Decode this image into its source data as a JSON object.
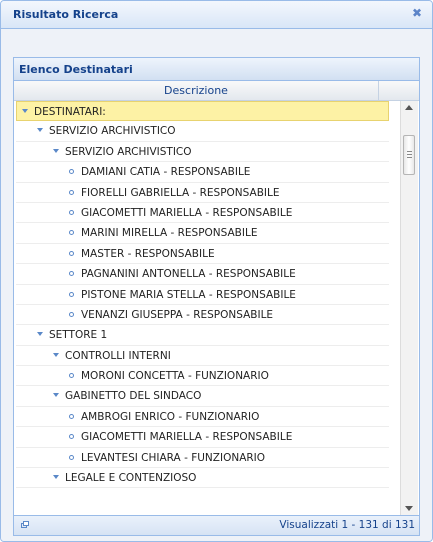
{
  "window": {
    "title": "Risultato Ricerca",
    "close_icon": "close-icon"
  },
  "panel": {
    "title": "Elenco Destinatari",
    "column_header": "Descrizione"
  },
  "tree": [
    {
      "label": "DESTINATARI:",
      "level": 0,
      "type": "folder",
      "selected": true
    },
    {
      "label": "SERVIZIO ARCHIVISTICO",
      "level": 1,
      "type": "folder"
    },
    {
      "label": "SERVIZIO ARCHIVISTICO",
      "level": 2,
      "type": "folder"
    },
    {
      "label": "DAMIANI CATIA - RESPONSABILE",
      "level": 3,
      "type": "leaf"
    },
    {
      "label": "FIORELLI GABRIELLA - RESPONSABILE",
      "level": 3,
      "type": "leaf"
    },
    {
      "label": "GIACOMETTI MARIELLA - RESPONSABILE",
      "level": 3,
      "type": "leaf"
    },
    {
      "label": "MARINI MIRELLA - RESPONSABILE",
      "level": 3,
      "type": "leaf"
    },
    {
      "label": "MASTER  - RESPONSABILE",
      "level": 3,
      "type": "leaf"
    },
    {
      "label": "PAGNANINI ANTONELLA - RESPONSABILE",
      "level": 3,
      "type": "leaf"
    },
    {
      "label": "PISTONE MARIA STELLA - RESPONSABILE",
      "level": 3,
      "type": "leaf"
    },
    {
      "label": "VENANZI GIUSEPPA - RESPONSABILE",
      "level": 3,
      "type": "leaf"
    },
    {
      "label": "SETTORE 1",
      "level": 1,
      "type": "folder"
    },
    {
      "label": "CONTROLLI INTERNI",
      "level": 2,
      "type": "folder"
    },
    {
      "label": "MORONI CONCETTA - FUNZIONARIO",
      "level": 3,
      "type": "leaf"
    },
    {
      "label": "GABINETTO DEL SINDACO",
      "level": 2,
      "type": "folder"
    },
    {
      "label": "AMBROGI ENRICO - FUNZIONARIO",
      "level": 3,
      "type": "leaf"
    },
    {
      "label": "GIACOMETTI MARIELLA - RESPONSABILE",
      "level": 3,
      "type": "leaf"
    },
    {
      "label": "LEVANTESI CHIARA - FUNZIONARIO",
      "level": 3,
      "type": "leaf"
    },
    {
      "label": "LEGALE E CONTENZIOSO",
      "level": 2,
      "type": "folder"
    }
  ],
  "footer": {
    "info": "Visualizzati 1 - 131 di 131",
    "refresh_icon": "refresh-icon"
  },
  "colors": {
    "accent": "#15428b",
    "border": "#99bbe8",
    "selected": "#fdf2a5"
  }
}
